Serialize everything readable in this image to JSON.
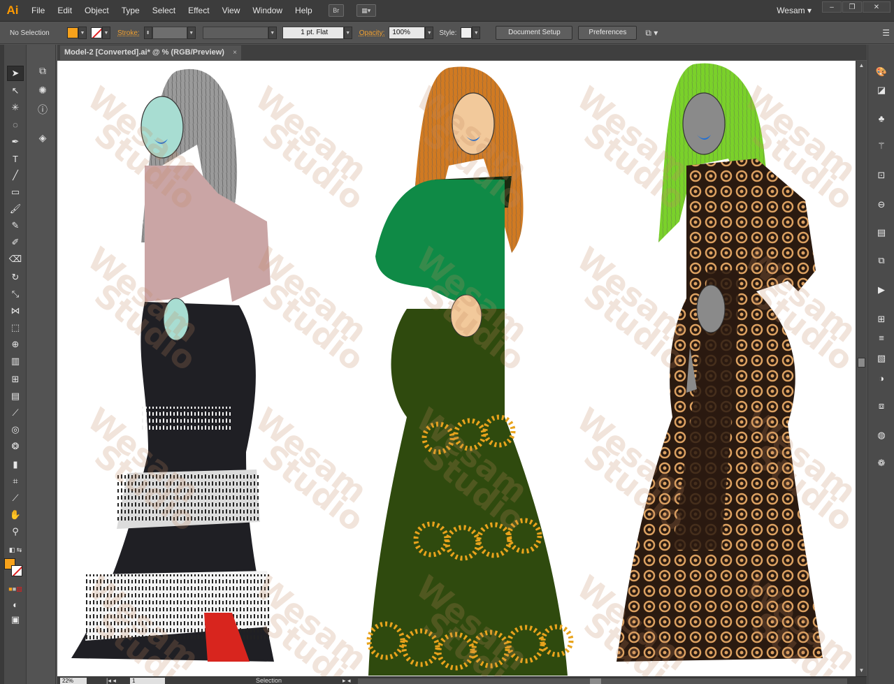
{
  "app": {
    "logo": "Ai",
    "workspace": "Wesam"
  },
  "menu": [
    "File",
    "Edit",
    "Object",
    "Type",
    "Select",
    "Effect",
    "View",
    "Window",
    "Help"
  ],
  "menubar_buttons": {
    "bridge": "Br"
  },
  "window_controls": {
    "minimize": "–",
    "restore": "❐",
    "close": "✕"
  },
  "control": {
    "selection": "No Selection",
    "fill_color": "#f7a21b",
    "stroke_label": "Stroke:",
    "brush": "1 pt. Flat",
    "opacity_label": "Opacity:",
    "opacity_value": "100%",
    "style_label": "Style:",
    "document_setup": "Document Setup",
    "preferences": "Preferences"
  },
  "document": {
    "tab_title": "Model-2 [Converted].ai* @ % (RGB/Preview)",
    "close": "×"
  },
  "watermark": [
    "Wesam",
    "Studio"
  ],
  "status": {
    "zoom": "22%",
    "page": "1",
    "mode": "Selection"
  },
  "figures": [
    {
      "hair": "#8a8a8a",
      "skin": "#a8ddd2",
      "top": "#caa5a5",
      "dress": "#1f1f24",
      "accent": "#d8d8d8"
    },
    {
      "hair": "#d07a22",
      "skin": "#f2c99b",
      "top": "#0f8a46",
      "dress": "#2f4a0e",
      "accent": "#e8a31c"
    },
    {
      "hair": "#7ad12a",
      "skin": "#8a8a8a",
      "top": "#2a1a10",
      "dress": "#2a1a10",
      "accent": "#f0b06a"
    }
  ],
  "colors": {
    "accent": "#ff9a00",
    "ui_dark": "#3c3c3c",
    "ui_mid": "#535353"
  }
}
